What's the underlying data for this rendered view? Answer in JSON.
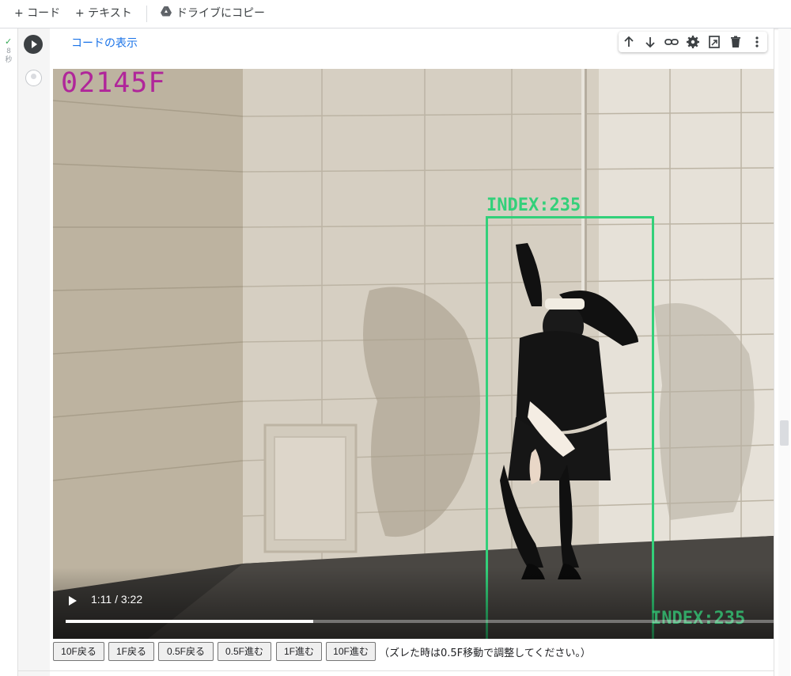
{
  "toolbar": {
    "add_code": "+ コード",
    "add_text": "+ テキスト",
    "copy_to_drive": "ドライブにコピー"
  },
  "cell": {
    "exec_status_icon": "check-icon",
    "exec_time": "8\n秒",
    "show_code_label": "コードの表示",
    "cell_toolbar_icons": [
      "arrow-up-icon",
      "arrow-down-icon",
      "link-icon",
      "gear-icon",
      "mirror-cell-icon",
      "trash-icon",
      "more-vert-icon"
    ]
  },
  "video": {
    "frame_label": "02145F",
    "bbox_label": "INDEX:235",
    "bbox_label_2": "INDEX:235",
    "time": "1:11 / 3:22",
    "progress": 0.35,
    "bbox_color": "#33d07a",
    "frame_label_color": "#b0269a"
  },
  "controls": {
    "buttons": [
      "10F戻る",
      "1F戻る",
      "0.5F戻る",
      "0.5F進む",
      "1F進む",
      "10F進む"
    ],
    "note": "（ズレた時は0.5F移動で調整してください。）"
  }
}
